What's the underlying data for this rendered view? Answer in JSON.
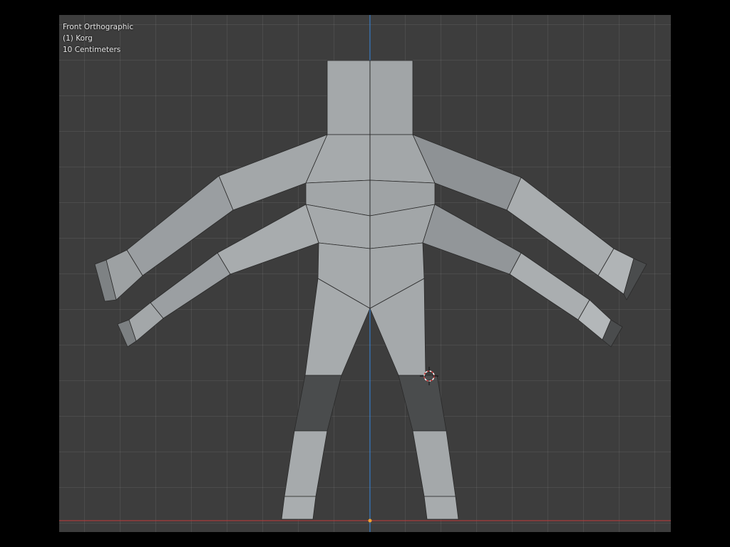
{
  "viewport": {
    "view_name": "Front Orthographic",
    "object_label": "(1) Korg",
    "grid_scale": "10 Centimeters"
  },
  "colors": {
    "background": "#3d3d3d",
    "mesh_light": "#a4a8aa",
    "mesh_mid": "#8f9396",
    "mesh_dark": "#4a4c4d",
    "x_axis": "#c23b3b",
    "z_axis": "#2f7fd6",
    "cursor": "#d04040"
  },
  "icons": {
    "cursor": "3d-cursor-icon",
    "origin": "origin-point-icon"
  }
}
